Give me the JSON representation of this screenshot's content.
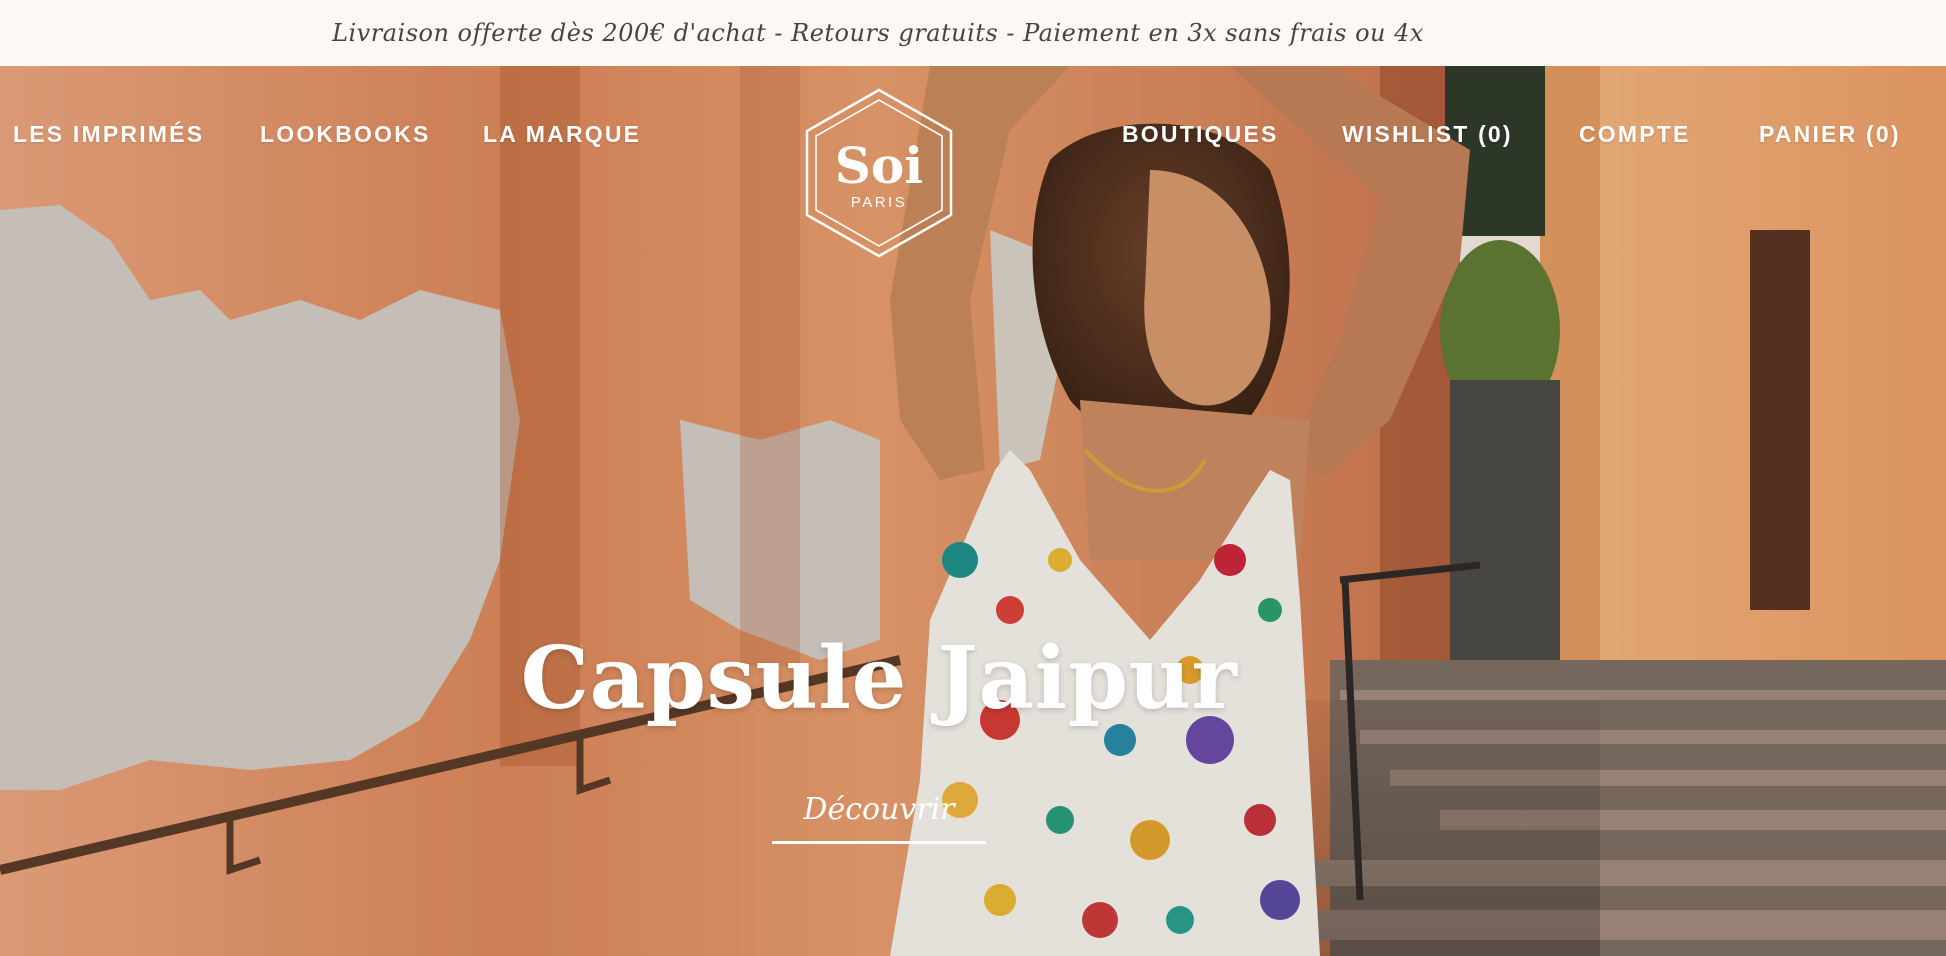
{
  "announcement": "Livraison offerte dès 200€ d'achat - Retours gratuits - Paiement en 3x sans frais ou 4x",
  "nav_left": [
    "LES IMPRIMÉS",
    "LOOKBOOKS",
    "LA MARQUE"
  ],
  "nav_right": [
    "BOUTIQUES",
    "WISHLIST (0)",
    "COMPTE",
    "PANIER (0)"
  ],
  "logo": {
    "name": "Soi",
    "subtitle": "PARIS"
  },
  "hero": {
    "title": "Capsule Jaipur",
    "cta": "Découvrir",
    "image": "woman-in-printed-dress-on-stairs"
  },
  "colors": {
    "announcement_bg": "#fcf8f6",
    "announcement_text": "#4a4440",
    "wall": "#d98a5e",
    "text_on_image": "#ffffff"
  }
}
